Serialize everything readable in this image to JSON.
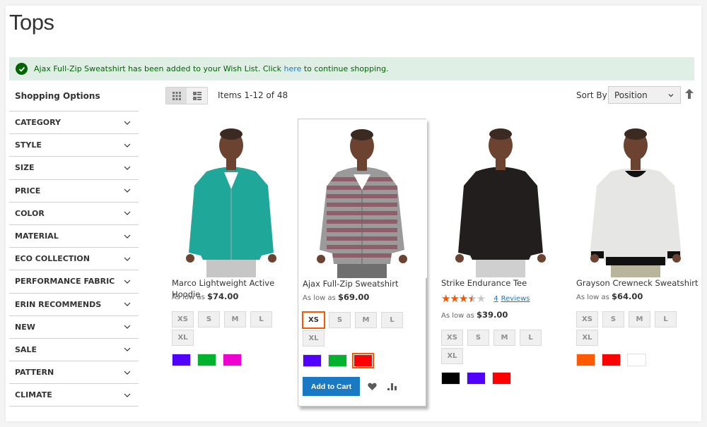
{
  "page": {
    "title": "Tops"
  },
  "message": {
    "text_before": "Ajax Full-Zip Sweatshirt has been added to your Wish List. Click ",
    "link": "here",
    "text_after": " to continue shopping.",
    "icon": "check-circle-icon"
  },
  "sidebar": {
    "title": "Shopping Options",
    "filters": [
      {
        "label": "CATEGORY"
      },
      {
        "label": "STYLE"
      },
      {
        "label": "SIZE"
      },
      {
        "label": "PRICE"
      },
      {
        "label": "COLOR"
      },
      {
        "label": "MATERIAL"
      },
      {
        "label": "ECO COLLECTION"
      },
      {
        "label": "PERFORMANCE FABRIC"
      },
      {
        "label": "ERIN RECOMMENDS"
      },
      {
        "label": "NEW"
      },
      {
        "label": "SALE"
      },
      {
        "label": "PATTERN"
      },
      {
        "label": "CLIMATE"
      }
    ]
  },
  "toolbar": {
    "modes": [
      {
        "name": "grid",
        "icon": "grid-icon",
        "active": true
      },
      {
        "name": "list",
        "icon": "list-icon",
        "active": false
      }
    ],
    "items_count": "Items 1-12 of 48",
    "sort_label": "Sort By",
    "sort_value": "Position",
    "sort_direction_icon": "arrow-up-icon"
  },
  "products": [
    {
      "name": "Marco Lightweight Active Hoodie",
      "price_prefix": "As low as",
      "price": "$74.00",
      "sizes": [
        "XS",
        "S",
        "M",
        "L",
        "XL"
      ],
      "selected_size": null,
      "colors": [
        "#5100ff",
        "#00b22d",
        "#ee00d0"
      ],
      "selected_color": null,
      "image": {
        "top_color": "#1fa79a",
        "pants_color": "#c6c6c6"
      }
    },
    {
      "name": "Ajax Full-Zip Sweatshirt",
      "price_prefix": "As low as",
      "price": "$69.00",
      "sizes": [
        "XS",
        "S",
        "M",
        "L",
        "XL"
      ],
      "selected_size": "XS",
      "colors": [
        "#5100ff",
        "#00b22d",
        "#ff0000"
      ],
      "selected_color": 2,
      "hovered": true,
      "add_to_cart": "Add to Cart",
      "wishlist_icon": "heart-icon",
      "compare_icon": "compare-chart-icon",
      "image": {
        "top_color": "#9a9a9a",
        "stripe_color": "#8c5561",
        "pants_color": "#6f6f6f"
      }
    },
    {
      "name": "Strike Endurance Tee",
      "rating": {
        "value": 3.5,
        "max": 5
      },
      "reviews_count": "4",
      "reviews_label": "Reviews",
      "price_prefix": "As low as",
      "price": "$39.00",
      "sizes": [
        "XS",
        "S",
        "M",
        "L",
        "XL"
      ],
      "selected_size": null,
      "colors": [
        "#000000",
        "#5100ff",
        "#ff0000"
      ],
      "selected_color": null,
      "image": {
        "top_color": "#231e1e",
        "pants_color": "#cfcfcf"
      }
    },
    {
      "name": "Grayson Crewneck Sweatshirt",
      "price_prefix": "As low as",
      "price": "$64.00",
      "sizes": [
        "XS",
        "S",
        "M",
        "L",
        "XL"
      ],
      "selected_size": null,
      "colors": [
        "#ff5a00",
        "#ff0000",
        "#ffffff"
      ],
      "selected_color": null,
      "image": {
        "top_color": "#e6e6e4",
        "trim_color": "#111111",
        "pants_color": "#b9b49c"
      }
    }
  ]
}
